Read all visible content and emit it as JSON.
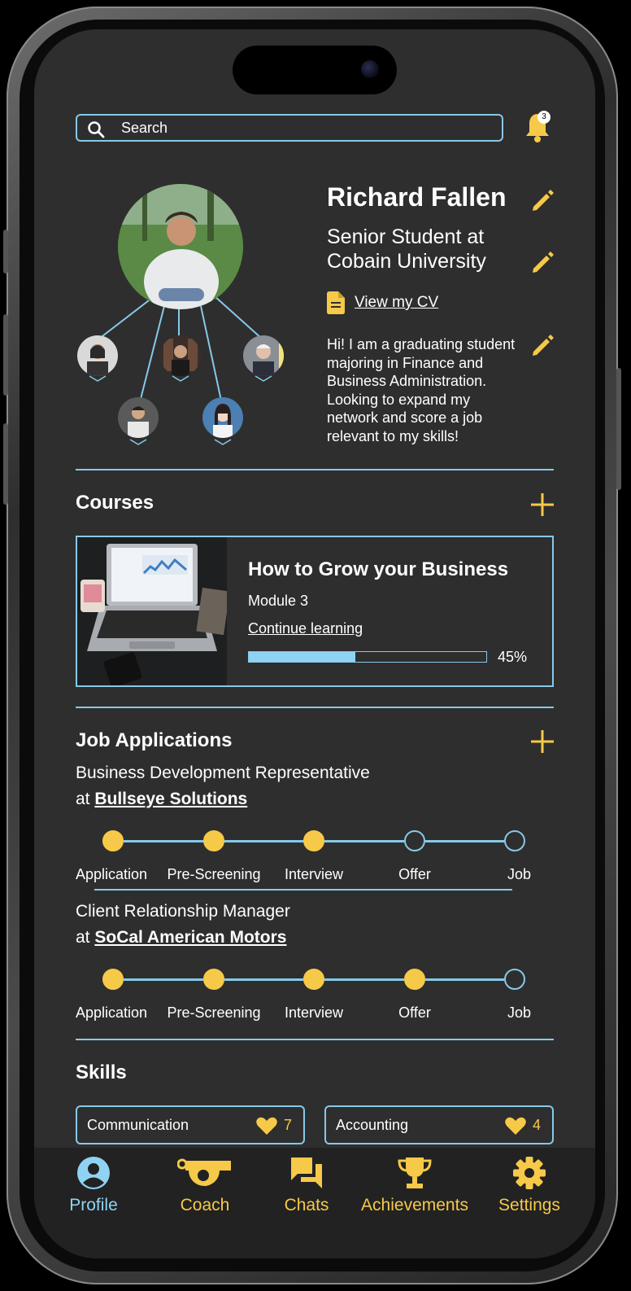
{
  "search": {
    "placeholder": "Search"
  },
  "notifications": {
    "count": "3"
  },
  "profile": {
    "name": "Richard Fallen",
    "title": "Senior Student at Cobain University",
    "cv_link": "View my CV",
    "bio": "Hi! I am a graduating student majoring in Finance and Business Administration. Looking to expand my network and score a job relevant to my skills!"
  },
  "courses": {
    "heading": "Courses",
    "items": [
      {
        "title": "How to Grow your Business",
        "module": "Module 3",
        "continue": "Continue learning",
        "progress": 45,
        "progress_label": "45%"
      }
    ]
  },
  "jobs": {
    "heading": "Job Applications",
    "stages": [
      "Application",
      "Pre-Screening",
      "Interview",
      "Offer",
      "Job"
    ],
    "items": [
      {
        "role": "Business Development Representative",
        "at": "at",
        "company": "Bullseye Solutions",
        "completed": 3
      },
      {
        "role": "Client Relationship Manager",
        "at": "at",
        "company": "SoCal American Motors",
        "completed": 4
      }
    ]
  },
  "skills": {
    "heading": "Skills",
    "items": [
      {
        "name": "Communication",
        "likes": "7"
      },
      {
        "name": "Accounting",
        "likes": "4"
      }
    ]
  },
  "tabs": [
    {
      "label": "Profile",
      "icon": "profile-icon",
      "active": true
    },
    {
      "label": "Coach",
      "icon": "whistle-icon",
      "active": false
    },
    {
      "label": "Chats",
      "icon": "chat-icon",
      "active": false
    },
    {
      "label": "Achievements",
      "icon": "trophy-icon",
      "active": false
    },
    {
      "label": "Settings",
      "icon": "gear-icon",
      "active": false
    }
  ],
  "colors": {
    "accent": "#f7c948",
    "outline": "#86c9e9",
    "background": "#2e2e2e",
    "active_tab": "#8fd3f2"
  }
}
